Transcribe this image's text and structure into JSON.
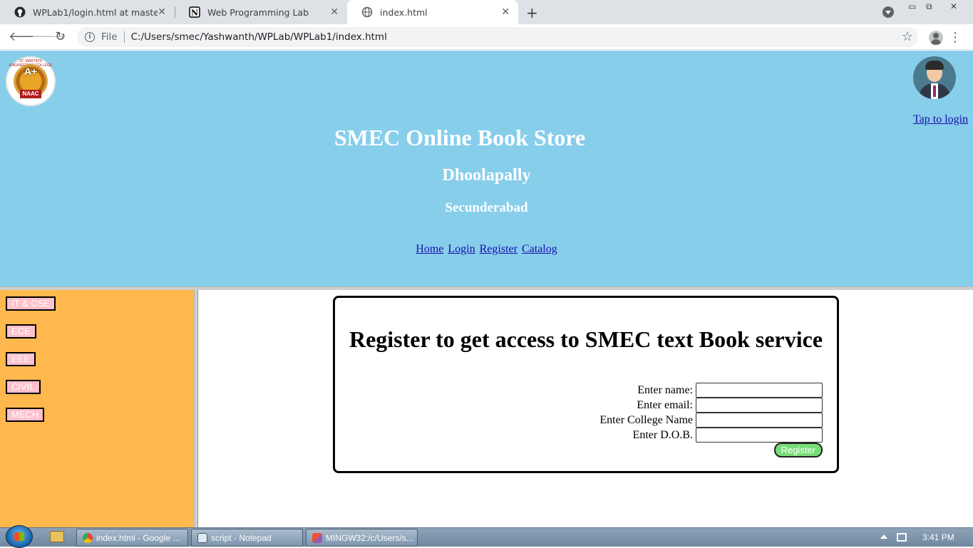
{
  "browser": {
    "tabs": [
      {
        "title": "WPLab1/login.html at master · ya",
        "icon": "github-icon"
      },
      {
        "title": "Web Programming Lab",
        "icon": "notion-icon"
      },
      {
        "title": "index.html",
        "icon": "globe-icon",
        "active": true
      }
    ],
    "address": {
      "scheme_label": "File",
      "url": "C:/Users/smec/Yashwanth/WPLab/WPLab1/index.html"
    }
  },
  "header": {
    "logo_text": "A+",
    "logo_badge": "NAAC",
    "logo_ring": "ST. MARTIN'S ENGINEERING COLLEGE",
    "login_link": "Tap to login",
    "title": "SMEC Online Book Store",
    "subtitle1": "Dhoolapally",
    "subtitle2": "Secunderabad",
    "nav": [
      "Home",
      "Login",
      "Register",
      "Catalog"
    ]
  },
  "sidebar": {
    "departments": [
      "IT & CSE",
      "ECE",
      "EEE",
      "CIVIL",
      "MECH"
    ]
  },
  "register_form": {
    "heading": "Register to get access to SMEC text Book service",
    "fields": [
      {
        "label": "Enter name:",
        "value": ""
      },
      {
        "label": "Enter email:",
        "value": ""
      },
      {
        "label": "Enter College Name",
        "value": ""
      },
      {
        "label": "Enter D.O.B.",
        "value": ""
      }
    ],
    "submit_label": "Register"
  },
  "taskbar": {
    "items": [
      {
        "label": "index.html - Google ...",
        "icon": "chrome-icon"
      },
      {
        "label": "script - Notepad",
        "icon": "notepad-icon"
      },
      {
        "label": "MINGW32:/c/Users/s...",
        "icon": "git-bash-icon"
      }
    ],
    "clock": "3:41 PM"
  }
}
